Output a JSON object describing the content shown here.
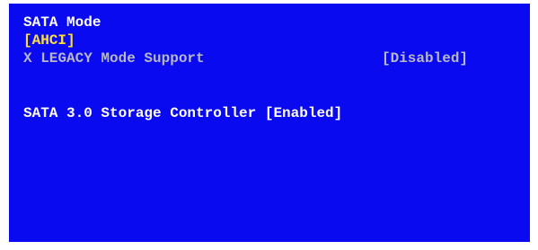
{
  "bios": {
    "sata_mode_label": "SATA Mode",
    "sata_mode_value": "[AHCI]",
    "legacy_support_label": "X LEGACY Mode Support",
    "legacy_support_value": "[Disabled]",
    "sata3_controller_text": "SATA 3.0 Storage Controller [Enabled]"
  },
  "colors": {
    "panel_background": "#0a0af0",
    "text_white": "#ffffff",
    "text_highlight_yellow": "#ffe135",
    "text_disabled_gray": "#b8b8c8"
  }
}
